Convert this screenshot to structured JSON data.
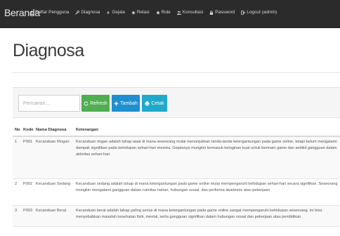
{
  "navbar": {
    "brand": "Beranda",
    "items": [
      {
        "label": "Daftar Pengguna",
        "icon": "user-icon"
      },
      {
        "label": "Diagnosa",
        "icon": "wrench-icon"
      },
      {
        "label": "Gejala",
        "icon": "bolt-icon"
      },
      {
        "label": "Relasi",
        "icon": "star-icon"
      },
      {
        "label": "Rule",
        "icon": "star-icon"
      },
      {
        "label": "Konsultasi",
        "icon": "users-icon"
      },
      {
        "label": "Password",
        "icon": "lock-icon"
      },
      {
        "label": "Logout (admin)",
        "icon": "logout-icon"
      }
    ]
  },
  "page": {
    "title": "Diagnosa"
  },
  "toolbar": {
    "search_placeholder": "Pencarian...",
    "refresh_label": "Refresh",
    "tambah_label": "Tambah",
    "cetak_label": "Cetak"
  },
  "colors": {
    "navbar_bg": "#2b2b2b",
    "refresh": "#4fae52",
    "tambah": "#1f8fd0",
    "cetak": "#1fa9cb"
  },
  "table": {
    "headers": [
      "No",
      "Kode",
      "Nama Diagnosa",
      "Keterangan"
    ],
    "rows": [
      {
        "no": "1",
        "kode": "P001",
        "nama": "Kecanduan Ringan",
        "keterangan": "Kecanduan ringan adalah tahap awal di mana seseorang mulai menunjukkan tanda-tanda ketergantungan pada game online, tetapi belum mengalami dampak signifikan pada kehidupan sehari-hari mereka. Gejalanya mungkin termasuk keinginan kuat untuk bermain game dan sedikit gangguan dalam aktivitas sehari-hari."
      },
      {
        "no": "2",
        "kode": "P002",
        "nama": "Kecanduan Sedang",
        "keterangan": "Kecanduan sedang adalah tahap di mana ketergantungan pada game online mulai mempengaruhi kehidupan sehari-hari secara signifikan. Seseorang mungkin mengalami gangguan dalam rutinitas harian, hubungan sosial, dan performa akademis atau pekerjaan."
      },
      {
        "no": "3",
        "kode": "P003",
        "nama": "Kecanduan Berat",
        "keterangan": "Kecanduan berat adalah tahap paling serius di mana ketergantungan pada game online sangat mempengaruhi kehidupan seseorang. Ini bisa menyebabkan masalah kesehatan fisik, mental, serta gangguan signifikan dalam hubungan sosial dan pekerjaan atau pendidikan."
      }
    ]
  }
}
